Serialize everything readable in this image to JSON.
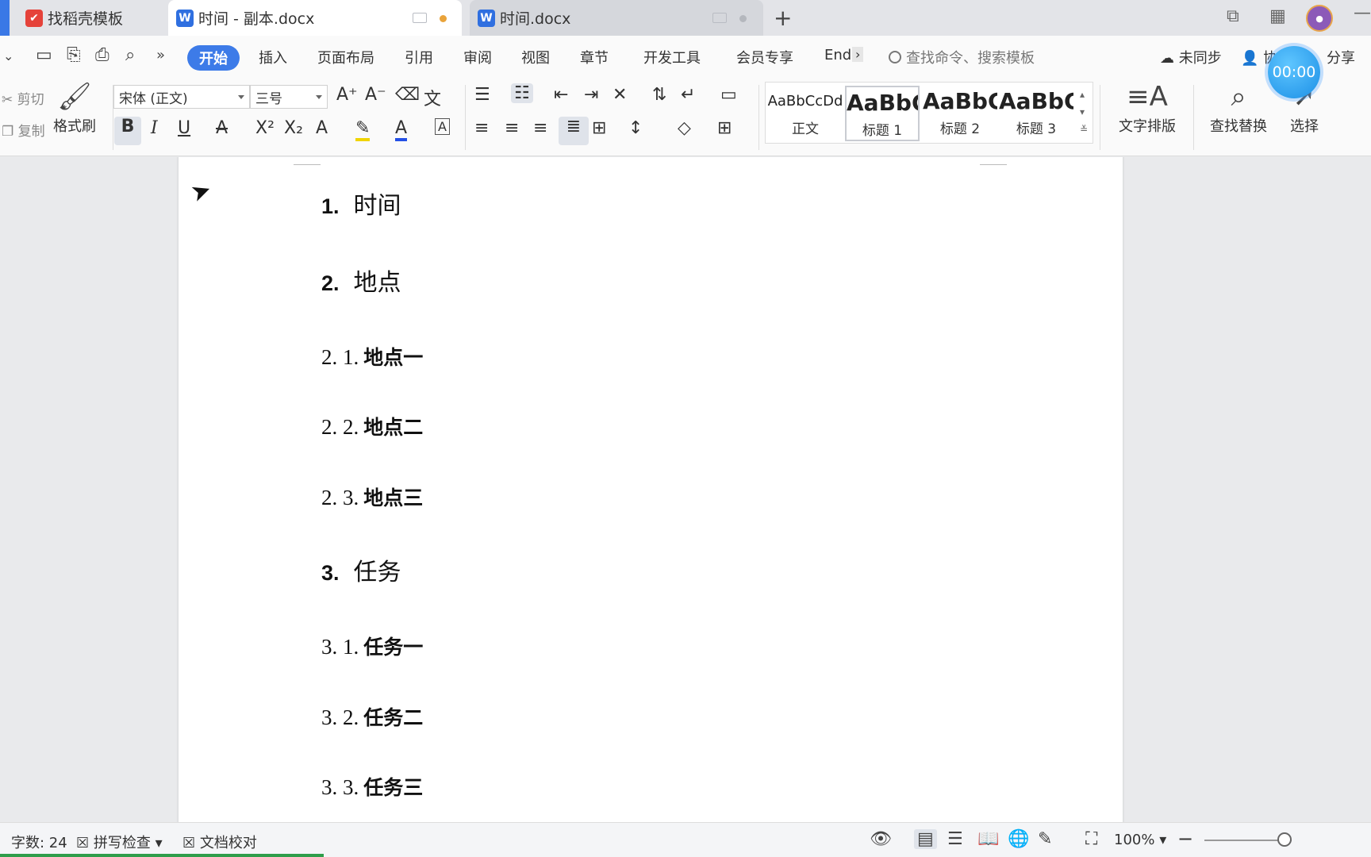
{
  "tabs": [
    {
      "label": "找稻壳模板",
      "icon": "docer-icon"
    },
    {
      "label": "时间 - 副本.docx",
      "icon": "wps-writer-icon"
    },
    {
      "label": "时间.docx",
      "icon": "wps-writer-icon"
    }
  ],
  "menu": {
    "items": [
      "开始",
      "插入",
      "页面布局",
      "引用",
      "审阅",
      "视图",
      "章节",
      "开发工具",
      "会员专享",
      "End"
    ],
    "search_placeholder": "查找命令、搜索模板",
    "sync": "未同步",
    "share": "分享",
    "timer": "00:00",
    "collab_partial": "协"
  },
  "ribbon": {
    "cut": "剪切",
    "copy": "复制",
    "format_painter": "格式刷",
    "font_name": "宋体 (正文)",
    "font_size": "三号",
    "styles": [
      {
        "sample": "AaBbCcDd",
        "label": "正文"
      },
      {
        "sample": "AaBbC",
        "label": "标题 1"
      },
      {
        "sample": "AaBbC",
        "label": "标题 2"
      },
      {
        "sample": "AaBbC",
        "label": "标题 3"
      }
    ],
    "text_layout": "文字排版",
    "find_replace": "查找替换",
    "select": "选择"
  },
  "document": {
    "lines": [
      {
        "num": "1.",
        "text": "时间",
        "level": 1
      },
      {
        "num": "2.",
        "text": "地点",
        "level": 1
      },
      {
        "num": "2. 1.",
        "text": "地点一",
        "level": 2
      },
      {
        "num": "2. 2.",
        "text": "地点二",
        "level": 2
      },
      {
        "num": "2. 3.",
        "text": "地点三",
        "level": 2
      },
      {
        "num": "3.",
        "text": "任务",
        "level": 1
      },
      {
        "num": "3. 1.",
        "text": "任务一",
        "level": 2
      },
      {
        "num": "3. 2.",
        "text": "任务二",
        "level": 2
      },
      {
        "num": "3. 3.",
        "text": "任务三",
        "level": 2
      }
    ]
  },
  "status": {
    "word_count": "字数: 24",
    "spell_check": "拼写检查",
    "doc_proof": "文档校对",
    "zoom": "100%"
  },
  "colors": {
    "accent": "#3d7be8",
    "docer_red": "#e5423a",
    "timer_blue": "#1b8fe6"
  }
}
